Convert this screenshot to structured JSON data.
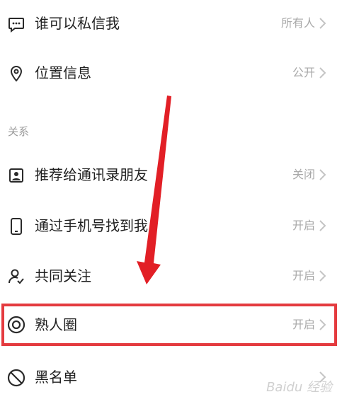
{
  "section_label": "关系",
  "rows": [
    {
      "id": "dm",
      "label": "谁可以私信我",
      "value": "所有人",
      "icon": "message-icon"
    },
    {
      "id": "location",
      "label": "位置信息",
      "value": "公开",
      "icon": "location-pin-icon"
    },
    {
      "id": "recommend",
      "label": "推荐给通讯录朋友",
      "value": "关闭",
      "icon": "contact-card-icon"
    },
    {
      "id": "phone",
      "label": "通过手机号找到我",
      "value": "开启",
      "icon": "phone-icon"
    },
    {
      "id": "mutual",
      "label": "共同关注",
      "value": "开启",
      "icon": "user-check-icon"
    },
    {
      "id": "acquaintance",
      "label": "熟人圈",
      "value": "开启",
      "icon": "target-circle-icon"
    },
    {
      "id": "blacklist",
      "label": "黑名单",
      "value": "",
      "icon": "block-icon"
    }
  ],
  "colors": {
    "highlight": "#e43b3f",
    "text": "#1f1f1f",
    "muted": "#a9a9a9"
  },
  "watermark": "Baidu 经验"
}
